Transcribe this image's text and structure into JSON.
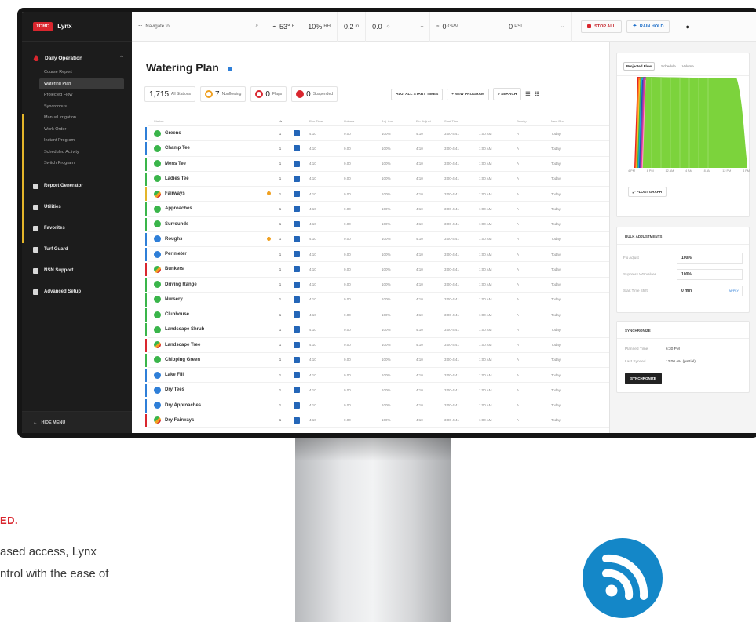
{
  "app": {
    "badge": "TORO",
    "name": "Lynx"
  },
  "sidebar": {
    "group": {
      "label": "Daily Operation",
      "items": [
        "Course Report",
        "Watering Plan",
        "Projected Flow",
        "Syncronous",
        "Manual Irrigation",
        "Work Order",
        "Instant Program",
        "Scheduled Activity",
        "Switch Program"
      ]
    },
    "main_items": [
      "Report Generator",
      "Utilities",
      "Favorites",
      "Turf Guard",
      "NSN Support",
      "Advanced Setup"
    ],
    "hide_menu": "HIDE MENU"
  },
  "topbar": {
    "search_placeholder": "Navigate to...",
    "temp": "53°",
    "temp_unit": "F",
    "humidity": "10%",
    "humidity_unit": "RH",
    "rain": "0.2",
    "rain_unit": "in",
    "et": "0.0",
    "flow1": "0",
    "flow1_unit": "GPM",
    "flow2": "0",
    "flow2_unit": "PSI",
    "stop_all": "STOP ALL",
    "rain_hold": "RAIN HOLD"
  },
  "page": {
    "title": "Watering Plan",
    "stats": {
      "stations": "1,715",
      "stations_label": "All Stations",
      "flagged": "7",
      "flagged_label": "Nonflowing",
      "flags": "0",
      "flags_label": "Flags",
      "suspended": "0",
      "suspended_label": "Suspended"
    },
    "actions": [
      "ADJ. ALL START TIMES",
      "+ NEW PROGRAM",
      "SEARCH"
    ]
  },
  "table": {
    "headers": [
      "Station",
      "",
      "Hr",
      "Run Time",
      "Volume",
      "Adj. Amt",
      "Flo. Adjust",
      "Start Time",
      "Priority",
      "Next Run"
    ],
    "rows": [
      {
        "name": "Greens",
        "status": "green",
        "flag": false,
        "bar": "#2f7fd8"
      },
      {
        "name": "Champ Tee",
        "status": "green",
        "flag": false,
        "bar": "#2f7fd8"
      },
      {
        "name": "Mens Tee",
        "status": "green",
        "flag": false,
        "bar": "#3ab54a"
      },
      {
        "name": "Ladies Tee",
        "status": "green",
        "flag": false,
        "bar": "#3ab54a"
      },
      {
        "name": "Fairways",
        "status": "mixed",
        "flag": true,
        "bar": "#e3b52a"
      },
      {
        "name": "Approaches",
        "status": "green",
        "flag": false,
        "bar": "#3ab54a"
      },
      {
        "name": "Surrounds",
        "status": "green",
        "flag": false,
        "bar": "#3ab54a"
      },
      {
        "name": "Roughs",
        "status": "blue",
        "flag": true,
        "bar": "#2f7fd8"
      },
      {
        "name": "Perimeter",
        "status": "blue",
        "flag": false,
        "bar": "#2f7fd8"
      },
      {
        "name": "Bunkers",
        "status": "mixed",
        "flag": false,
        "bar": "#d9262e"
      },
      {
        "name": "Driving Range",
        "status": "green",
        "flag": false,
        "bar": "#3ab54a"
      },
      {
        "name": "Nursery",
        "status": "green",
        "flag": false,
        "bar": "#3ab54a"
      },
      {
        "name": "Clubhouse",
        "status": "green",
        "flag": false,
        "bar": "#3ab54a"
      },
      {
        "name": "Landscape Shrub",
        "status": "green",
        "flag": false,
        "bar": "#3ab54a"
      },
      {
        "name": "Landscape Tree",
        "status": "mixed",
        "flag": false,
        "bar": "#d9262e"
      },
      {
        "name": "Chipping Green",
        "status": "green",
        "flag": false,
        "bar": "#3ab54a"
      },
      {
        "name": "Lake Fill",
        "status": "blue",
        "flag": false,
        "bar": "#2f7fd8"
      },
      {
        "name": "Dry Tees",
        "status": "blue",
        "flag": false,
        "bar": "#2f7fd8"
      },
      {
        "name": "Dry Approaches",
        "status": "blue",
        "flag": false,
        "bar": "#2f7fd8"
      },
      {
        "name": "Dry Fairways",
        "status": "mixed",
        "flag": false,
        "bar": "#d9262e"
      }
    ],
    "cell_values": [
      "1",
      "4:10",
      "0.00",
      "100%",
      "4:10",
      "3:00-4:41",
      "1:00 AM",
      "A",
      "Today"
    ]
  },
  "right_panel": {
    "tabs": [
      "Projected Flow",
      "Schedule",
      "Volume"
    ],
    "x_ticks": [
      "4 PM",
      "8 PM",
      "12 AM",
      "4 AM",
      "8 AM",
      "12 PM",
      "4 PM"
    ],
    "float_graph": "FLOAT GRAPH",
    "bulk": {
      "title": "BULK ADJUSTMENTS",
      "rows": [
        {
          "label": "Flo Adjust",
          "value": "100%"
        },
        {
          "label": "Suppress Wtr Values",
          "value": "100%"
        },
        {
          "label": "Start Time Shift",
          "value": "0 min",
          "apply": "APPLY"
        }
      ]
    },
    "sync": {
      "title": "SYNCHRONIZE",
      "rows": [
        {
          "label": "Planned Time",
          "value": "6:30 PM"
        },
        {
          "label": "Last Synced",
          "value": "12:00 AM (partial)"
        }
      ],
      "button": "SYNCHRONIZE"
    }
  },
  "caption": {
    "heading": "ED.",
    "body": "ased access, Lynx\nntrol with the ease of"
  },
  "colors": {
    "brand_red": "#d9262e",
    "accent_blue": "#2f7fd8",
    "status_green": "#3ab54a",
    "status_orange": "#f0a020",
    "wifi_blue": "#1487c8"
  },
  "chart_data": {
    "type": "area",
    "title": "",
    "x": [
      "4 PM",
      "8 PM",
      "12 AM",
      "4 AM",
      "8 AM",
      "12 PM",
      "4 PM"
    ],
    "series_colors": [
      "#e52420",
      "#ff7f1e",
      "#f7c628",
      "#3ab54a",
      "#1ca2d9",
      "#2a4cb0",
      "#8b3fb0",
      "#e23c97",
      "#ff9bc8",
      "#7cd33c"
    ],
    "note": "stacked area flow profile; full height from ~8 PM to ~4 AM, tapering after"
  }
}
